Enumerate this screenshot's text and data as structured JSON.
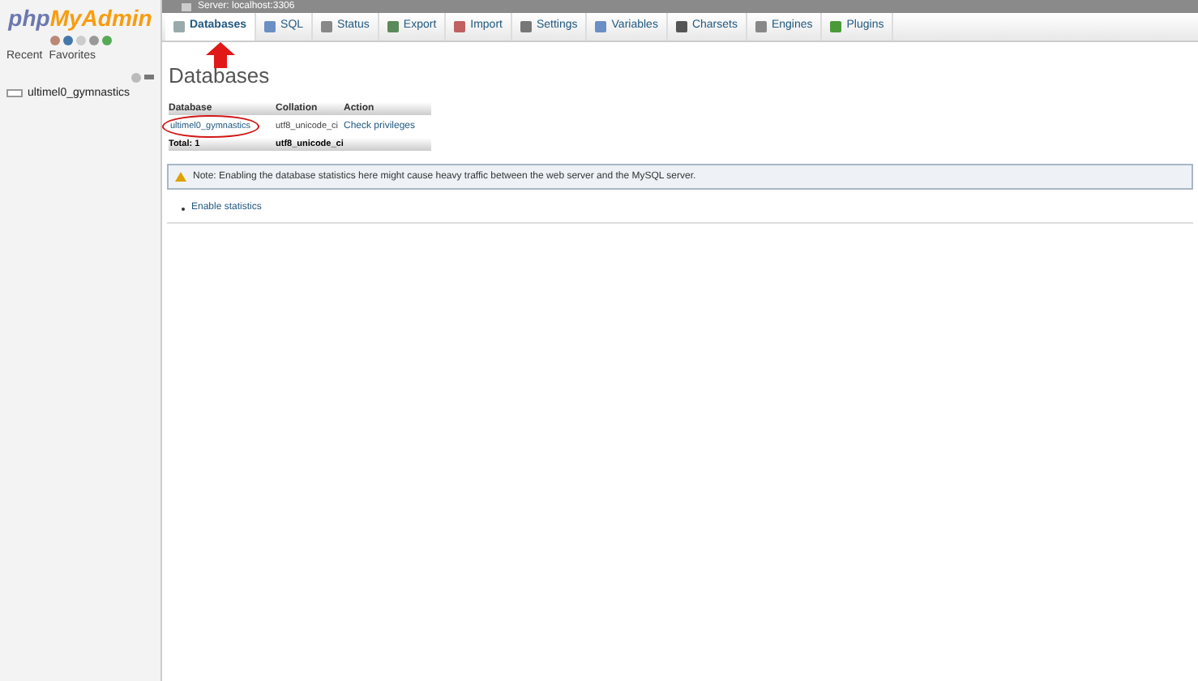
{
  "sidebar": {
    "logo_left": "php",
    "logo_right": "MyAdmin",
    "tabs": [
      "Recent",
      "Favorites"
    ],
    "tree": [
      {
        "label": "ultimel0_gymnastics"
      }
    ]
  },
  "server_title": "Server: localhost:3306",
  "tabs": [
    {
      "label": "Databases",
      "selected": true
    },
    {
      "label": "SQL",
      "selected": false
    },
    {
      "label": "Status",
      "selected": false
    },
    {
      "label": "Export",
      "selected": false
    },
    {
      "label": "Import",
      "selected": false
    },
    {
      "label": "Settings",
      "selected": false
    },
    {
      "label": "Variables",
      "selected": false
    },
    {
      "label": "Charsets",
      "selected": false
    },
    {
      "label": "Engines",
      "selected": false
    },
    {
      "label": "Plugins",
      "selected": false
    }
  ],
  "heading": "Databases",
  "table": {
    "columns": [
      "Database",
      "Collation",
      "Action"
    ],
    "rows": [
      {
        "database": "ultimel0_gymnastics",
        "collation": "utf8_unicode_ci",
        "action": "Check privileges"
      }
    ],
    "total": {
      "label": "Total: 1",
      "collation": "utf8_unicode_ci"
    }
  },
  "note": "Note: Enabling the database statistics here might cause heavy traffic between the web server and the MySQL server.",
  "link": "Enable statistics"
}
